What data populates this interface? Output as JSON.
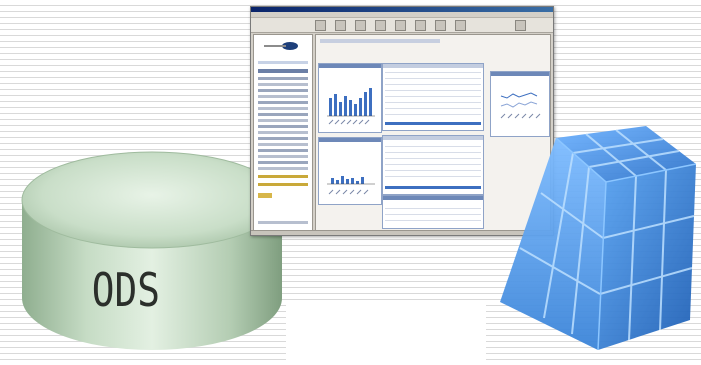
{
  "cylinder": {
    "label": "ODS"
  },
  "colors": {
    "cylinder": "#cfe3cf",
    "cylinder_shadow": "#8fae8f",
    "cube_face": "#4f97e6",
    "cube_edge": "#2f73c9",
    "cube_highlight": "#bde0ff",
    "window_chrome": "#d4d0c8",
    "window_title": "#0a246a",
    "stripes": "#d9d9d9"
  }
}
